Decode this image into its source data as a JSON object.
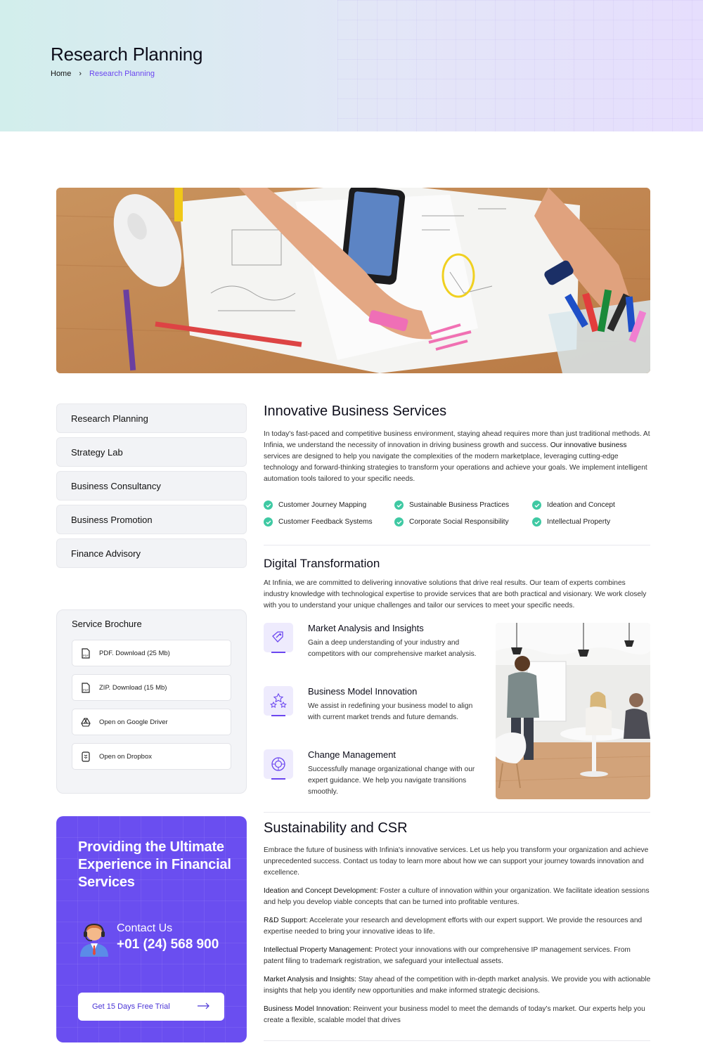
{
  "header": {
    "title": "Research Planning",
    "breadcrumb": {
      "home": "Home",
      "separator": "›",
      "current": "Research Planning"
    }
  },
  "sidebar": {
    "items": [
      {
        "label": "Research Planning"
      },
      {
        "label": "Strategy Lab"
      },
      {
        "label": "Business Consultancy"
      },
      {
        "label": "Business Promotion"
      },
      {
        "label": "Finance Advisory"
      }
    ]
  },
  "brochure": {
    "title": "Service Brochure",
    "items": [
      {
        "label": "PDF. Download (25 Mb)",
        "icon": "pdf-file-icon"
      },
      {
        "label": "ZIP. Download (15 Mb)",
        "icon": "zip-file-icon"
      },
      {
        "label": "Open on Google Driver",
        "icon": "google-drive-icon"
      },
      {
        "label": "Open on Dropbox",
        "icon": "dropbox-icon"
      }
    ]
  },
  "promo": {
    "title": "Providing the Ultimate Experience in Financial Services",
    "contact_label": "Contact Us",
    "phone": "+01 (24) 568 900",
    "cta": "Get 15 Days Free Trial"
  },
  "main": {
    "section1": {
      "title": "Innovative Business Services",
      "p_start": "In today's fast-paced and competitive business environment, staying ahead requires more than just traditional methods. At Infinia, we understand the necessity of innovation in driving business growth and success. ",
      "p_bold": "Our innovative business",
      "p_end": " services are designed to help you navigate the complexities of the modern marketplace, leveraging cutting-edge technology and forward-thinking strategies to transform your operations and achieve your goals. We implement intelligent automation tools tailored to your specific needs.",
      "checks": [
        "Customer Journey Mapping",
        "Sustainable Business Practices",
        "Ideation and Concept",
        "Customer Feedback Systems",
        "Corporate Social Responsibility",
        "Intellectual Property"
      ]
    },
    "section2": {
      "title": "Digital Transformation",
      "paragraph": "At Infinia, we are committed to delivering innovative solutions that drive real results. Our team of experts combines industry knowledge with technological expertise to provide services that are both practical and visionary. We work closely with you to understand your unique challenges and tailor our services to meet your specific needs.",
      "features": [
        {
          "title": "Market Analysis and Insights",
          "text": "Gain a deep understanding of your industry and competitors with our comprehensive market analysis."
        },
        {
          "title": "Business Model Innovation",
          "text": "We assist in redefining your business model to align with current market trends and future demands."
        },
        {
          "title": "Change Management",
          "text": "Successfully manage organizational change with our expert guidance. We help you navigate transitions smoothly."
        }
      ]
    },
    "section3": {
      "title": "Sustainability and CSR",
      "intro": "Embrace the future of business with Infinia's innovative services. Let us help you transform your organization and achieve unprecedented success. Contact us today to learn more about how we can support your journey towards innovation and excellence.",
      "items": [
        {
          "label": "Ideation and Concept Development:",
          "text": " Foster a culture of innovation within your organization. We facilitate ideation sessions and help you develop viable concepts that can be turned into profitable ventures."
        },
        {
          "label": "R&D Support:",
          "text": " Accelerate your research and development efforts with our expert support. We provide the resources and expertise needed to bring your innovative ideas to life."
        },
        {
          "label": "Intellectual Property Management:",
          "text": " Protect your innovations with our comprehensive IP management services. From patent filing to trademark registration, we safeguard your intellectual assets."
        },
        {
          "label": "Market Analysis and Insights:",
          "text": " Stay ahead of the competition with in-depth market analysis. We provide you with actionable insights that help you identify new opportunities and make informed strategic decisions."
        },
        {
          "label": "Business Model Innovation:",
          "text": " Reinvent your business model to meet the demands of today's market. Our experts help you create a flexible, scalable model that drives"
        }
      ]
    }
  },
  "colors": {
    "accent": "#6b46f0",
    "check": "#3fc9a3",
    "promo_bg": "#6a4ef0"
  }
}
